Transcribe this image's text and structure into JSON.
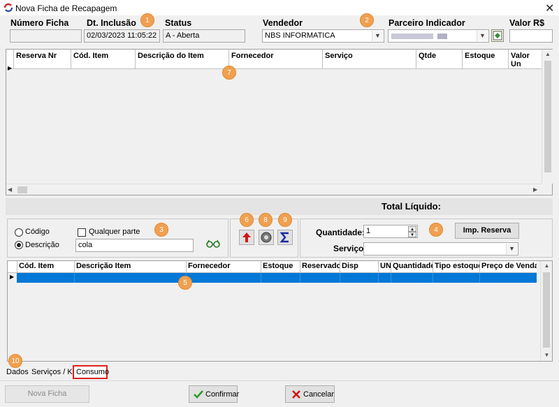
{
  "window": {
    "title": "Nova Ficha de Recapagem",
    "close_glyph": "✕"
  },
  "header": {
    "numero_ficha_label": "Número Ficha",
    "numero_ficha_value": "",
    "dt_inclusao_label": "Dt. Inclusão",
    "dt_inclusao_value": "02/03/2023 11:05:22",
    "status_label": "Status",
    "status_value": "A - Aberta",
    "vendedor_label": "Vendedor",
    "vendedor_value": "NBS INFORMATICA",
    "parceiro_label": "Parceiro Indicador",
    "parceiro_value": "",
    "valor_label": "Valor R$",
    "valor_value": ""
  },
  "badges": [
    "1",
    "2",
    "3",
    "4",
    "5",
    "6",
    "7",
    "8",
    "9",
    "10"
  ],
  "reserva_grid": {
    "columns": [
      "Reserva Nr",
      "Cód. Item",
      "Descrição do Item",
      "Fornecedor",
      "Serviço",
      "Qtde",
      "Estoque",
      "Valor Un"
    ]
  },
  "total_liquido_label": "Total Líquido:",
  "search": {
    "codigo_label": "Código",
    "descricao_label": "Descrição",
    "qualquer_parte_label": "Qualquer parte",
    "search_value": "cola",
    "selected_mode": "descricao"
  },
  "quantidade": {
    "label": "Quantidade:",
    "value": "1"
  },
  "servico": {
    "label": "Serviço:",
    "value": ""
  },
  "imp_reserva_label": "Imp. Reserva",
  "itens_grid": {
    "columns": [
      "Cód. Item",
      "Descrição Item",
      "Fornecedor",
      "Estoque",
      "Reservado",
      "Disp",
      "UN",
      "Quantidade",
      "Tipo estoque",
      "Preço de Venda"
    ]
  },
  "tabs": [
    "Dados",
    "Serviços / Kit",
    "Consumo"
  ],
  "active_tab": "Consumo",
  "footer": {
    "nova_ficha_label": "Nova Ficha",
    "confirmar_label": "Confirmar",
    "cancelar_label": "Cancelar"
  },
  "colors": {
    "accent_badge": "#f0a050",
    "selection": "#0078d7",
    "active_tab_border": "#e02020"
  },
  "icons": [
    "app-icon",
    "glasses-icon",
    "up-arrow-icon",
    "wheel-icon",
    "sigma-icon",
    "spin-up-icon",
    "spin-down-icon",
    "check-icon",
    "x-icon",
    "partner-lookup-icon",
    "chevron-down-icon"
  ]
}
